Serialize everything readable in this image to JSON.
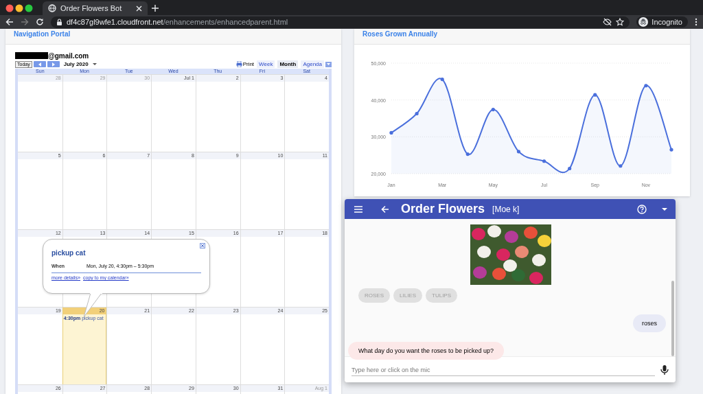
{
  "browser": {
    "tab_title": "Order Flowers Bot",
    "url_host": "df4c87gl9wfe1.cloudfront.net",
    "url_path": "/enhancements/enhancedparent.html",
    "profile": "Incognito"
  },
  "navigation_portal": {
    "title": "Navigation Portal",
    "account": "@gmail.com",
    "today_button": "Today",
    "month": "July 2020",
    "print": "Print",
    "views": [
      {
        "label": "Week",
        "selected": false
      },
      {
        "label": "Month",
        "selected": true
      },
      {
        "label": "Agenda",
        "selected": false
      }
    ],
    "weekdays": [
      "Sun",
      "Mon",
      "Tue",
      "Wed",
      "Thu",
      "Fri",
      "Sat"
    ],
    "weeks": [
      {
        "days": [
          {
            "label": "28",
            "other_month": true,
            "highlighted": false
          },
          {
            "label": "29",
            "other_month": true,
            "highlighted": false
          },
          {
            "label": "30",
            "other_month": true,
            "highlighted": false
          },
          {
            "label": "Jul 1",
            "other_month": false,
            "highlighted": false
          },
          {
            "label": "2",
            "other_month": false,
            "highlighted": false
          },
          {
            "label": "3",
            "other_month": false,
            "highlighted": false
          },
          {
            "label": "4",
            "other_month": false,
            "highlighted": false
          }
        ]
      },
      {
        "days": [
          {
            "label": "5",
            "other_month": false,
            "highlighted": false
          },
          {
            "label": "6",
            "other_month": false,
            "highlighted": false
          },
          {
            "label": "7",
            "other_month": false,
            "highlighted": false
          },
          {
            "label": "8",
            "other_month": false,
            "highlighted": false
          },
          {
            "label": "9",
            "other_month": false,
            "highlighted": false
          },
          {
            "label": "10",
            "other_month": false,
            "highlighted": false
          },
          {
            "label": "11",
            "other_month": false,
            "highlighted": false
          }
        ]
      },
      {
        "days": [
          {
            "label": "12",
            "other_month": false,
            "highlighted": false
          },
          {
            "label": "13",
            "other_month": false,
            "highlighted": false
          },
          {
            "label": "14",
            "other_month": false,
            "highlighted": false
          },
          {
            "label": "15",
            "other_month": false,
            "highlighted": false
          },
          {
            "label": "16",
            "other_month": false,
            "highlighted": false
          },
          {
            "label": "17",
            "other_month": false,
            "highlighted": false
          },
          {
            "label": "18",
            "other_month": false,
            "highlighted": false
          }
        ]
      },
      {
        "days": [
          {
            "label": "19",
            "other_month": false,
            "highlighted": false
          },
          {
            "label": "20",
            "other_month": false,
            "highlighted": true,
            "events": [
              "**4:30pm** pickup cat"
            ]
          },
          {
            "label": "21",
            "other_month": false,
            "highlighted": false
          },
          {
            "label": "22",
            "other_month": false,
            "highlighted": false
          },
          {
            "label": "23",
            "other_month": false,
            "highlighted": false
          },
          {
            "label": "24",
            "other_month": false,
            "highlighted": false
          },
          {
            "label": "25",
            "other_month": false,
            "highlighted": false
          }
        ]
      },
      {
        "days": [
          {
            "label": "26",
            "other_month": false,
            "highlighted": false
          },
          {
            "label": "27",
            "other_month": false,
            "highlighted": false
          },
          {
            "label": "28",
            "other_month": false,
            "highlighted": false
          },
          {
            "label": "29",
            "other_month": false,
            "highlighted": false
          },
          {
            "label": "30",
            "other_month": false,
            "highlighted": false
          },
          {
            "label": "31",
            "other_month": false,
            "highlighted": false
          },
          {
            "label": "Aug 1",
            "other_month": true,
            "highlighted": false
          }
        ]
      }
    ],
    "event_popup": {
      "title": "pickup cat",
      "when_label": "When",
      "when": "Mon, July 20, 4:30pm – 5:30pm",
      "links": [
        "more details»",
        "copy to my calendar»"
      ]
    }
  },
  "roses_chart": {
    "title": "Roses Grown Annually",
    "chart_data": {
      "type": "area",
      "categories": [
        "Jan",
        null,
        "Mar",
        null,
        "May",
        null,
        "Jul",
        null,
        "Sep",
        null,
        "Nov",
        null
      ],
      "series": [
        {
          "color": "#4a6fdc",
          "values": [
            31100,
            36300,
            45600,
            25300,
            37400,
            26000,
            23400,
            21400,
            41400,
            22100,
            43900,
            26500
          ]
        }
      ],
      "ylim": [
        20000,
        50000
      ],
      "yticks": [
        {
          "value": 20000,
          "label": "20,000"
        },
        {
          "value": 30000,
          "label": "30,000"
        },
        {
          "value": 40000,
          "label": "40,000"
        },
        {
          "value": 50000,
          "label": "50,000"
        }
      ]
    }
  },
  "chat": {
    "title": "Order Flowers",
    "user": "[Moe k]",
    "card": {
      "buttons": [
        {
          "label": "ROSES",
          "disabled": true
        },
        {
          "label": "LILIES",
          "disabled": true
        },
        {
          "label": "TULIPS",
          "disabled": true
        }
      ]
    },
    "messages": [
      {
        "kind": "user",
        "text": "roses"
      },
      {
        "kind": "bot",
        "text": "What day do you want the roses to be picked up?"
      }
    ],
    "input": {
      "placeholder": "Type here or click on the mic"
    }
  }
}
